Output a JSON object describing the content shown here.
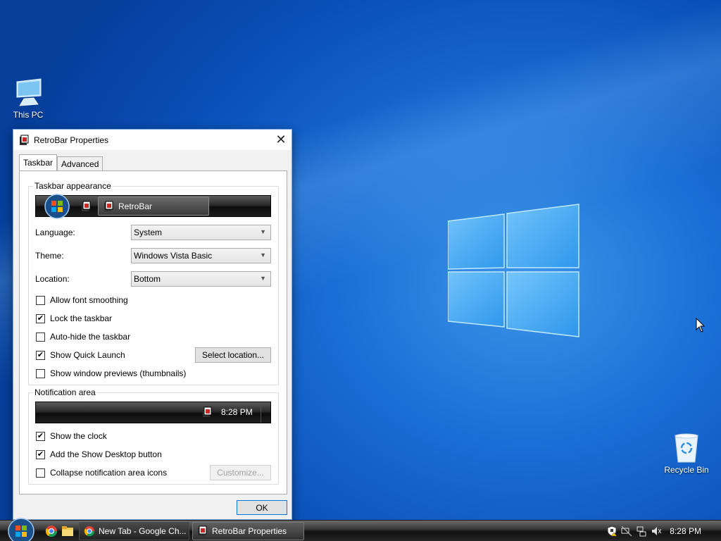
{
  "desktop": {
    "icons": [
      {
        "label": "This PC",
        "icon": "computer-icon"
      },
      {
        "label": "Recycle Bin",
        "icon": "recycle-bin-icon"
      }
    ],
    "accent_color": "#1a6fd6"
  },
  "dialog": {
    "title": "RetroBar Properties",
    "close_glyph": "✕",
    "tabs": [
      {
        "label": "Taskbar",
        "active": true
      },
      {
        "label": "Advanced",
        "active": false
      }
    ],
    "taskbar_appearance": {
      "group_label": "Taskbar appearance",
      "preview_button_label": "RetroBar"
    },
    "fields": {
      "language": {
        "label": "Language:",
        "value": "System"
      },
      "theme": {
        "label": "Theme:",
        "value": "Windows Vista Basic"
      },
      "location": {
        "label": "Location:",
        "value": "Bottom"
      }
    },
    "options": [
      {
        "label": "Allow font smoothing",
        "checked": false
      },
      {
        "label": "Lock the taskbar",
        "checked": true
      },
      {
        "label": "Auto-hide the taskbar",
        "checked": false
      },
      {
        "label": "Show Quick Launch",
        "checked": true
      },
      {
        "label": "Show window previews (thumbnails)",
        "checked": false
      }
    ],
    "select_location_label": "Select location...",
    "notification_area": {
      "group_label": "Notification area",
      "preview_clock": "8:28 PM",
      "options": [
        {
          "label": "Show the clock",
          "checked": true
        },
        {
          "label": "Add the Show Desktop button",
          "checked": true
        },
        {
          "label": "Collapse notification area icons",
          "checked": false
        }
      ],
      "customize_label": "Customize..."
    },
    "ok_label": "OK",
    "check_glyph": "✔"
  },
  "taskbar": {
    "buttons": [
      {
        "label": "New Tab - Google Ch...",
        "icon": "chrome-icon",
        "active": false
      },
      {
        "label": "RetroBar Properties",
        "icon": "retrobar-icon",
        "active": true
      }
    ],
    "clock": "8:28 PM"
  }
}
